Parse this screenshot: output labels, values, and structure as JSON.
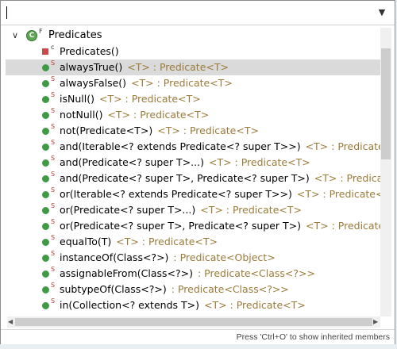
{
  "filter": {
    "value": ""
  },
  "tree": {
    "class_label": "Predicates",
    "class_modifier": "F",
    "members": [
      {
        "sup": "c",
        "name": "Predicates()",
        "ret": ""
      },
      {
        "sup": "S",
        "name": "alwaysTrue()",
        "ret": "<T> : Predicate<T>",
        "selected": true
      },
      {
        "sup": "S",
        "name": "alwaysFalse()",
        "ret": "<T> : Predicate<T>"
      },
      {
        "sup": "S",
        "name": "isNull()",
        "ret": "<T> : Predicate<T>"
      },
      {
        "sup": "S",
        "name": "notNull()",
        "ret": "<T> : Predicate<T>"
      },
      {
        "sup": "S",
        "name": "not(Predicate<T>)",
        "ret": "<T> : Predicate<T>"
      },
      {
        "sup": "S",
        "name": "and(Iterable<? extends Predicate<? super T>>)",
        "ret": "<T> : Predicate<T>"
      },
      {
        "sup": "S",
        "name": "and(Predicate<? super T>...)",
        "ret": "<T> : Predicate<T>"
      },
      {
        "sup": "S",
        "name": "and(Predicate<? super T>, Predicate<? super T>)",
        "ret": "<T> : Predicate<T>"
      },
      {
        "sup": "S",
        "name": "or(Iterable<? extends Predicate<? super T>>)",
        "ret": "<T> : Predicate<T>"
      },
      {
        "sup": "S",
        "name": "or(Predicate<? super T>...)",
        "ret": "<T> : Predicate<T>"
      },
      {
        "sup": "S",
        "name": "or(Predicate<? super T>, Predicate<? super T>)",
        "ret": "<T> : Predicate<T>"
      },
      {
        "sup": "S",
        "name": "equalTo(T)",
        "ret": "<T> : Predicate<T>"
      },
      {
        "sup": "S",
        "name": "instanceOf(Class<?>)",
        "ret": ": Predicate<Object>"
      },
      {
        "sup": "S",
        "name": "assignableFrom(Class<?>)",
        "ret": ": Predicate<Class<?>>"
      },
      {
        "sup": "S",
        "name": "subtypeOf(Class<?>)",
        "ret": ": Predicate<Class<?>>"
      },
      {
        "sup": "S",
        "name": "in(Collection<? extends T>)",
        "ret": "<T> : Predicate<T>"
      }
    ]
  },
  "status": {
    "hint": "Press 'Ctrl+O' to show inherited members"
  },
  "colors": {
    "selected_bg": "#dadada",
    "return_type": "#9a7b3a",
    "method_icon": "#3f9a48"
  }
}
